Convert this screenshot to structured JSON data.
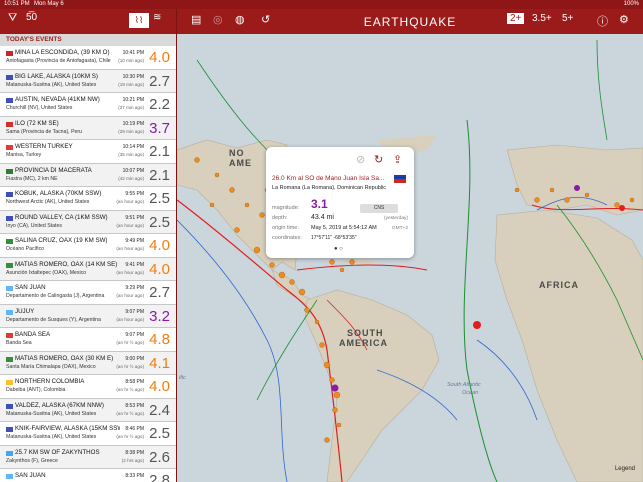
{
  "status_bar": {
    "time": "10:51 PM",
    "date": "Mon May 6",
    "battery": "100%"
  },
  "app_title": "EARTHQUAKE",
  "panel": {
    "header": "TODAY'S EVENTS",
    "filter_icon": "filter-icon",
    "wave_icon": "seismograph-icon",
    "alt_icon": "waves-icon"
  },
  "events": [
    {
      "place": "MINA LA ESCONDIDA, (39 KM O)",
      "sub": "Antofagasta (Provincia de Antofagasta), Chile",
      "time": "10:41 PM",
      "ago": "(10 min ago)",
      "mag": "4.0",
      "color": "#f07d11",
      "flag": "#c62828"
    },
    {
      "place": "BIG LAKE, ALASKA (10KM S)",
      "sub": "Matanuska-Susitna (AK), United States",
      "time": "10:30 PM",
      "ago": "(19 min ago)",
      "mag": "2.7",
      "color": "#555555",
      "flag": "#3f51b5"
    },
    {
      "place": "AUSTIN, NEVADA (41KM NW)",
      "sub": "Churchill (NV), United States",
      "time": "10:21 PM",
      "ago": "(27 min ago)",
      "mag": "2.2",
      "color": "#555555",
      "flag": "#3f51b5"
    },
    {
      "place": "ILO (72 KM SE)",
      "sub": "Sama (Provincia de Tacna), Peru",
      "time": "10:19 PM",
      "ago": "(29 min ago)",
      "mag": "3.7",
      "color": "#8a1aa8",
      "flag": "#d32f2f"
    },
    {
      "place": "WESTERN TURKEY",
      "sub": "Manisa, Turkey",
      "time": "10:14 PM",
      "ago": "(35 min ago)",
      "mag": "2.1",
      "color": "#555555",
      "flag": "#e53935"
    },
    {
      "place": "PROVINCIA DI MACERATA",
      "sub": "Fiastra (MC), 2 km NE",
      "time": "10:07 PM",
      "ago": "(42 min ago)",
      "mag": "2.1",
      "color": "#555555",
      "flag": "#2e7d32"
    },
    {
      "place": "KOBUK, ALASKA (70KM SSW)",
      "sub": "Northwest Arctic (AK), United States",
      "time": "9:55 PM",
      "ago": "(an hour ago)",
      "mag": "2.5",
      "color": "#555555",
      "flag": "#3f51b5"
    },
    {
      "place": "ROUND VALLEY, CA (1KM SSW)",
      "sub": "Inyo (CA), United States",
      "time": "9:51 PM",
      "ago": "(an hour ago)",
      "mag": "2.5",
      "color": "#555555",
      "flag": "#3f51b5"
    },
    {
      "place": "SALINA CRUZ, OAX (19 KM SW)",
      "sub": "Océano Pacífico",
      "time": "9:49 PM",
      "ago": "(an hour ago)",
      "mag": "4.0",
      "color": "#f07d11",
      "flag": "#388e3c"
    },
    {
      "place": "MATIAS ROMERO, OAX (14 KM SE)",
      "sub": "Asunción Ixtaltepec (OAX), Mexico",
      "time": "9:41 PM",
      "ago": "(an hour ago)",
      "mag": "4.0",
      "color": "#f07d11",
      "flag": "#388e3c"
    },
    {
      "place": "SAN JUAN",
      "sub": "Departamento de Calingasta (J), Argentina",
      "time": "9:29 PM",
      "ago": "(an hour ago)",
      "mag": "2.7",
      "color": "#555555",
      "flag": "#64b5f6"
    },
    {
      "place": "JUJUY",
      "sub": "Departamento de Susques (Y), Argentina",
      "time": "9:07 PM",
      "ago": "(an hour ago)",
      "mag": "3.2",
      "color": "#8a1aa8",
      "flag": "#64b5f6"
    },
    {
      "place": "BANDA SEA",
      "sub": "Banda Sea",
      "time": "9:07 PM",
      "ago": "(an hr ½ ago)",
      "mag": "4.8",
      "color": "#f07d11",
      "flag": "#e53935"
    },
    {
      "place": "MATIAS ROMERO, OAX (30 KM E)",
      "sub": "Santa María Chimalapa (OAX), Mexico",
      "time": "9:00 PM",
      "ago": "(an hr ½ ago)",
      "mag": "4.1",
      "color": "#f07d11",
      "flag": "#388e3c"
    },
    {
      "place": "NORTHERN COLOMBIA",
      "sub": "Dabeiba (ANT), Colombia",
      "time": "8:58 PM",
      "ago": "(an hr ½ ago)",
      "mag": "4.0",
      "color": "#f07d11",
      "flag": "#fbc02d"
    },
    {
      "place": "VALDEZ, ALASKA (67KM NNW)",
      "sub": "Matanuska-Susitna (AK), United States",
      "time": "8:53 PM",
      "ago": "(an hr ½ ago)",
      "mag": "2.4",
      "color": "#555555",
      "flag": "#3f51b5"
    },
    {
      "place": "KNIK-FAIRVIEW, ALASKA (15KM SSW)",
      "sub": "Matanuska-Susitna (AK), United States",
      "time": "8:46 PM",
      "ago": "(an hr ½ ago)",
      "mag": "2.5",
      "color": "#555555",
      "flag": "#3f51b5"
    },
    {
      "place": "25.7 KM SW OF ZAKYNTHOS",
      "sub": "Zakynthos (F), Greece",
      "time": "8:38 PM",
      "ago": "(2 hrs ago)",
      "mag": "2.6",
      "color": "#555555",
      "flag": "#42a5f5"
    },
    {
      "place": "SAN JUAN",
      "sub": "",
      "time": "8:33 PM",
      "ago": "",
      "mag": "2.8",
      "color": "#555555",
      "flag": "#64b5f6"
    }
  ],
  "toolbar": {
    "doc_icon": "document-icon",
    "locate_icon": "location-icon",
    "globe_icon": "globe-icon",
    "history_icon": "history-icon",
    "mag_filters": [
      "2+",
      "3.5+",
      "5+"
    ],
    "info_icon": "info-icon",
    "settings_icon": "gear-icon"
  },
  "map_labels": {
    "north_america": "NORTH AMERICA",
    "south_america": "SOUTH AMERICA",
    "africa": "AFRICA",
    "south_atlantic": "South Atlantic Ocean",
    "pacific": "Pacific",
    "legend": "Legend"
  },
  "popup": {
    "title": "26.0 Km al SO de Mano Juan Isla Sa...",
    "location": "La Romana (La Romana), Dominican Republic",
    "magnitude_label": "magnitude:",
    "magnitude": "3.1",
    "agency": "CNS",
    "depth_label": "depth:",
    "depth": "43.4 mi",
    "depth_note": "(yesterday)",
    "origin_label": "origin time:",
    "origin": "May 5, 2019 at 5:54:12 AM",
    "origin_tz": "GMT+2",
    "coords_label": "coordinates:",
    "coords": "17°57'11\"  -68°53'35\""
  }
}
